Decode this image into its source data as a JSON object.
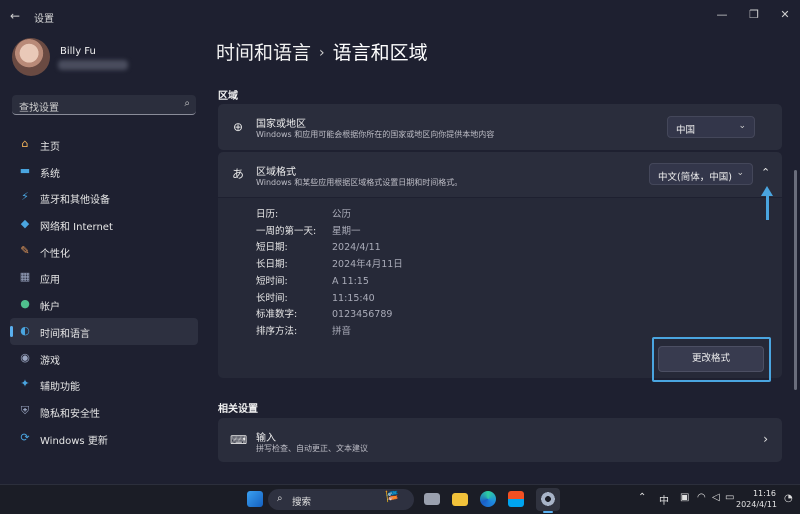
{
  "window": {
    "title": "设置",
    "controls": {
      "minimize": "—",
      "maximize": "❐",
      "close": "✕"
    }
  },
  "user": {
    "name": "Billy Fu"
  },
  "search": {
    "placeholder": "查找设置"
  },
  "nav": {
    "items": [
      {
        "label": "主页",
        "icon": "home-icon",
        "glyph": "⌂",
        "color": "#f3b35a",
        "active": false
      },
      {
        "label": "系统",
        "icon": "monitor-icon",
        "glyph": "▬",
        "color": "#4aa5e0",
        "active": false
      },
      {
        "label": "蓝牙和其他设备",
        "icon": "bluetooth-icon",
        "glyph": "⚡",
        "color": "#4aa5e0",
        "active": false
      },
      {
        "label": "网络和 Internet",
        "icon": "wifi-icon",
        "glyph": "◆",
        "color": "#4aa5e0",
        "active": false
      },
      {
        "label": "个性化",
        "icon": "brush-icon",
        "glyph": "✎",
        "color": "#e59a5a",
        "active": false
      },
      {
        "label": "应用",
        "icon": "apps-icon",
        "glyph": "▦",
        "color": "#9aa5c0",
        "active": false
      },
      {
        "label": "帐户",
        "icon": "person-icon",
        "glyph": "●",
        "color": "#4fc08d",
        "active": false
      },
      {
        "label": "时间和语言",
        "icon": "globe-clock-icon",
        "glyph": "◐",
        "color": "#4aa5e0",
        "active": true
      },
      {
        "label": "游戏",
        "icon": "gamepad-icon",
        "glyph": "◉",
        "color": "#9aa5c0",
        "active": false
      },
      {
        "label": "辅助功能",
        "icon": "accessibility-icon",
        "glyph": "✦",
        "color": "#4aa5e0",
        "active": false
      },
      {
        "label": "隐私和安全性",
        "icon": "shield-icon",
        "glyph": "⛨",
        "color": "#9aa5c0",
        "active": false
      },
      {
        "label": "Windows 更新",
        "icon": "update-icon",
        "glyph": "⟳",
        "color": "#4aa5e0",
        "active": false
      }
    ]
  },
  "breadcrumb": {
    "parent": "时间和语言",
    "separator": "›",
    "current": "语言和区域"
  },
  "region": {
    "heading": "区域",
    "country": {
      "title": "国家或地区",
      "desc": "Windows 和应用可能会根据你所在的国家或地区向你提供本地内容",
      "value": "中国"
    },
    "format": {
      "title": "区域格式",
      "desc": "Windows 和某些应用根据区域格式设置日期和时间格式。",
      "value": "中文(简体，中国)",
      "rows": [
        {
          "key": "日历:",
          "value": "公历"
        },
        {
          "key": "一周的第一天:",
          "value": "星期一"
        },
        {
          "key": "短日期:",
          "value": "2024/4/11"
        },
        {
          "key": "长日期:",
          "value": "2024年4月11日"
        },
        {
          "key": "短时间:",
          "value": "A 11:15"
        },
        {
          "key": "长时间:",
          "value": "11:15:40"
        },
        {
          "key": "标准数字:",
          "value": "0123456789"
        },
        {
          "key": "排序方法:",
          "value": "拼音"
        }
      ],
      "change_button": "更改格式"
    }
  },
  "related": {
    "heading": "相关设置",
    "input": {
      "title": "输入",
      "desc": "拼写检查、自动更正、文本建议"
    }
  },
  "taskbar": {
    "search_label": "搜索",
    "tray": {
      "ime": "中"
    },
    "clock": {
      "time": "11:16",
      "date": "2024/4/11"
    }
  },
  "accent": "#4aa5e0"
}
